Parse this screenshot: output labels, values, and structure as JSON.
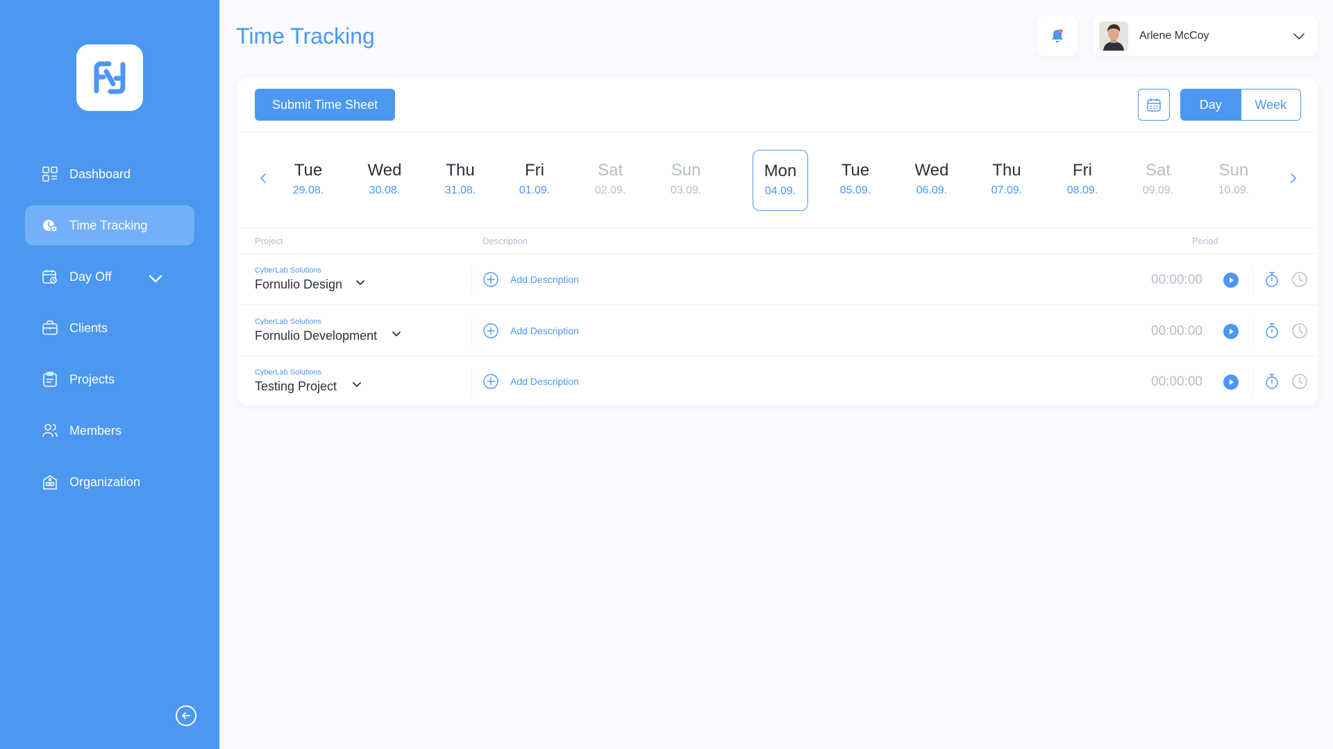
{
  "page": {
    "title": "Time Tracking"
  },
  "colors": {
    "primary": "#4b97f2",
    "muted": "#b5bdca",
    "text": "#2b2f3a",
    "bell_dot": "#f0746a"
  },
  "sidebar": {
    "logo_icon": "fornulio-logo-icon",
    "items": [
      {
        "label": "Dashboard",
        "icon": "dashboard-icon"
      },
      {
        "label": "Time Tracking",
        "icon": "time-tracking-icon",
        "active": true
      },
      {
        "label": "Day Off",
        "icon": "calendar-day-off-icon",
        "has_submenu": true
      },
      {
        "label": "Clients",
        "icon": "briefcase-icon"
      },
      {
        "label": "Projects",
        "icon": "clipboard-icon"
      },
      {
        "label": "Members",
        "icon": "users-icon"
      },
      {
        "label": "Organization",
        "icon": "building-icon"
      }
    ],
    "collapse_icon": "arrow-left-circle-icon"
  },
  "header": {
    "notification_icon": "bell-icon",
    "user": {
      "name": "Arlene McCoy",
      "avatar_icon": "avatar"
    }
  },
  "toolbar": {
    "submit_label": "Submit Time Sheet",
    "calendar_icon": "calendar-icon",
    "view_options": [
      "Day",
      "Week"
    ],
    "selected_view": "Day"
  },
  "days": [
    {
      "name": "Tue",
      "date": "29.08.",
      "weekend": false
    },
    {
      "name": "Wed",
      "date": "30.08.",
      "weekend": false
    },
    {
      "name": "Thu",
      "date": "31.08.",
      "weekend": false
    },
    {
      "name": "Fri",
      "date": "01.09.",
      "weekend": false
    },
    {
      "name": "Sat",
      "date": "02.09.",
      "weekend": true
    },
    {
      "name": "Sun",
      "date": "03.09.",
      "weekend": true
    },
    {
      "name": "Mon",
      "date": "04.09.",
      "weekend": false,
      "selected": true
    },
    {
      "name": "Tue",
      "date": "05.09.",
      "weekend": false
    },
    {
      "name": "Wed",
      "date": "06.09.",
      "weekend": false
    },
    {
      "name": "Thu",
      "date": "07.09.",
      "weekend": false
    },
    {
      "name": "Fri",
      "date": "08.09.",
      "weekend": false
    },
    {
      "name": "Sat",
      "date": "09.09.",
      "weekend": true
    },
    {
      "name": "Sun",
      "date": "10.09.",
      "weekend": true
    }
  ],
  "table": {
    "columns": {
      "project": "Project",
      "description": "Description",
      "period": "Period"
    },
    "rows": [
      {
        "client": "CyberLab Solutions",
        "project": "Fornulio Design",
        "add_label": "Add Description",
        "time": "00:00:00"
      },
      {
        "client": "CyberLab Solutions",
        "project": "Fornulio Development",
        "add_label": "Add Description",
        "time": "00:00:00"
      },
      {
        "client": "CyberLab Solutions",
        "project": "Testing Project",
        "add_label": "Add Description",
        "time": "00:00:00"
      }
    ]
  }
}
